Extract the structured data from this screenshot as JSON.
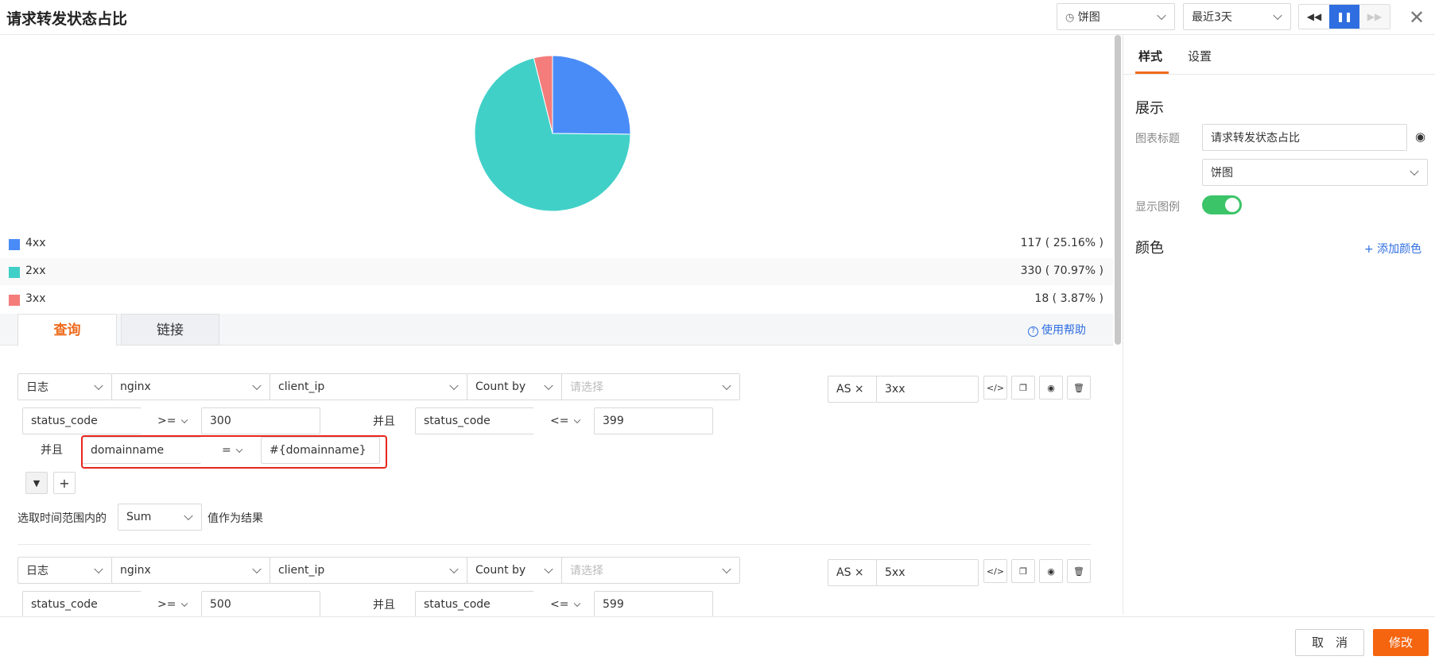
{
  "header": {
    "title": "请求转发状态占比",
    "chart_type_select": "饼图",
    "time_range_select": "最近3天"
  },
  "chart_data": {
    "type": "pie",
    "categories": [
      "4xx",
      "2xx",
      "3xx"
    ],
    "values": [
      117,
      330,
      18
    ],
    "percent_labels": [
      "117 ( 25.16% )",
      "330 ( 70.97% )",
      "18 ( 3.87% )"
    ],
    "colors": [
      "#4a8cf7",
      "#41d0c8",
      "#f47d7c"
    ]
  },
  "query_tabs": {
    "items": [
      "查询",
      "链接"
    ],
    "active": 0,
    "help_label": "使用帮助"
  },
  "query1": {
    "source": "日志",
    "index": "nginx",
    "field": "client_ip",
    "agg": "Count by",
    "groupby_placeholder": "请选择",
    "as_label": "AS ×",
    "as_value": "3xx",
    "cond1_field": "status_code",
    "cond1_op": ">=",
    "cond1_value": "300",
    "and_label": "并且",
    "cond2_field": "status_code",
    "cond2_op": "<=",
    "cond2_value": "399",
    "cond3_field": "domainname",
    "cond3_op": "=",
    "cond3_value": "#{domainname}",
    "result_prefix": "选取时间范围内的",
    "result_func": "Sum",
    "result_suffix": "值作为结果"
  },
  "query2": {
    "source": "日志",
    "index": "nginx",
    "field": "client_ip",
    "agg": "Count by",
    "groupby_placeholder": "请选择",
    "as_label": "AS ×",
    "as_value": "5xx",
    "cond1_field": "status_code",
    "cond1_op": ">=",
    "cond1_value": "500",
    "and_label": "并且",
    "cond2_field": "status_code",
    "cond2_op": "<=",
    "cond2_value": "599"
  },
  "panel": {
    "tabs": [
      "样式",
      "设置"
    ],
    "display_heading": "展示",
    "chart_title_label": "图表标题",
    "chart_title_value": "请求转发状态占比",
    "chart_type_value": "饼图",
    "show_legend_label": "显示图例",
    "show_legend": true,
    "color_heading": "颜色",
    "add_color_label": "+ 添加颜色"
  },
  "footer": {
    "cancel_label": "取　消",
    "submit_label": "修改"
  }
}
